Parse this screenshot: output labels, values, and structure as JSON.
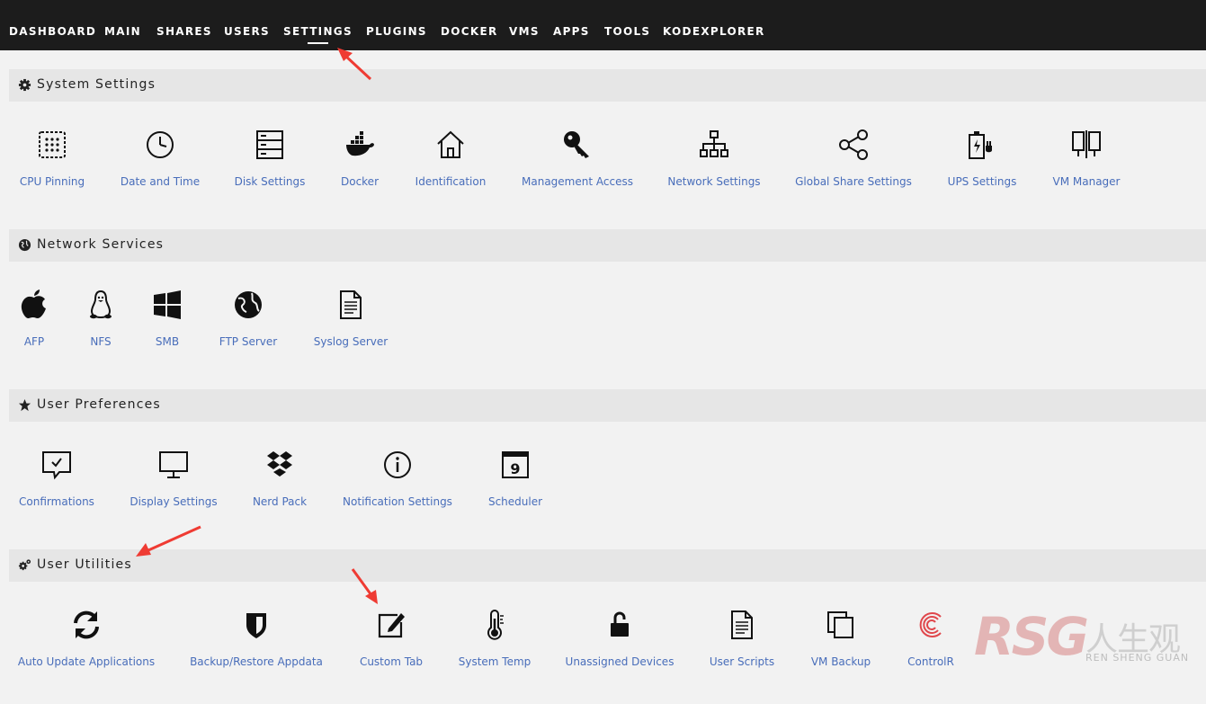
{
  "nav": [
    "DASHBOARD",
    "MAIN",
    "SHARES",
    "USERS",
    "SETTINGS",
    "PLUGINS",
    "DOCKER",
    "VMS",
    "APPS",
    "TOOLS",
    "KODEXPLORER"
  ],
  "nav_active": "SETTINGS",
  "sections": {
    "system": {
      "title": "System Settings",
      "items": [
        "CPU Pinning",
        "Date and Time",
        "Disk Settings",
        "Docker",
        "Identification",
        "Management Access",
        "Network Settings",
        "Global Share Settings",
        "UPS Settings",
        "VM Manager"
      ]
    },
    "network": {
      "title": "Network Services",
      "items": [
        "AFP",
        "NFS",
        "SMB",
        "FTP Server",
        "Syslog Server"
      ]
    },
    "prefs": {
      "title": "User Preferences",
      "items": [
        "Confirmations",
        "Display Settings",
        "Nerd Pack",
        "Notification Settings",
        "Scheduler"
      ]
    },
    "utils": {
      "title": "User Utilities",
      "items": [
        "Auto Update Applications",
        "Backup/Restore Appdata",
        "Custom Tab",
        "System Temp",
        "Unassigned Devices",
        "User Scripts",
        "VM Backup",
        "ControlR"
      ]
    }
  },
  "scheduler_day": "9",
  "watermark": {
    "logo": "RSG",
    "cn": "人生观",
    "pinyin": "REN SHENG GUAN"
  },
  "colors": {
    "nav_bg": "#1c1c1c",
    "link": "#486dba",
    "section_bg": "#e6e6e6",
    "page_bg": "#f2f2f2",
    "arrow": "#ef3b33"
  },
  "icons": {
    "system_settings": "gear-icon",
    "network_services": "globe-icon",
    "user_preferences": "star-icon",
    "user_utilities": "gears-icon"
  }
}
